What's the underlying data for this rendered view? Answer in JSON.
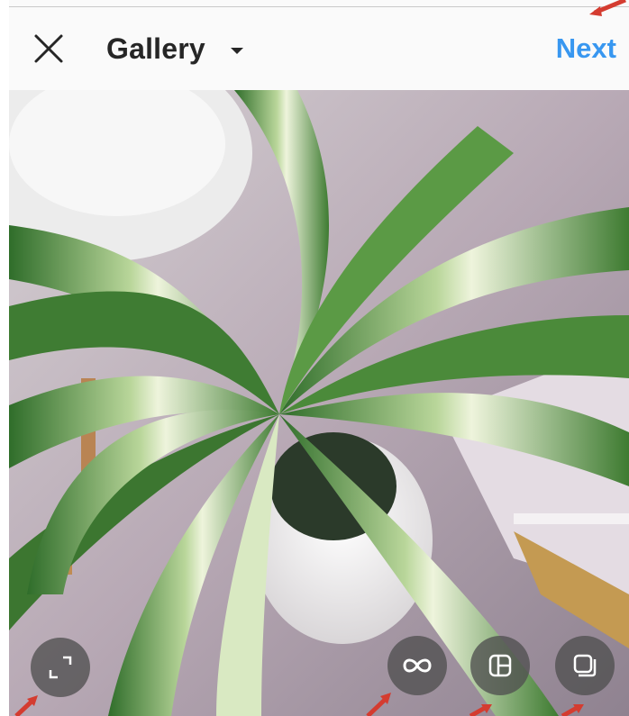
{
  "header": {
    "title": "Gallery",
    "next_label": "Next"
  },
  "icons": {
    "close": "close-icon",
    "dropdown": "caret-down-icon",
    "expand": "expand-icon",
    "boomerang": "infinity-icon",
    "layout": "layout-icon",
    "multi_select": "multi-select-icon"
  },
  "colors": {
    "accent": "#3897f0",
    "title_text": "#262626",
    "annotation_arrow": "#d43c30",
    "control_background": "#505050"
  }
}
